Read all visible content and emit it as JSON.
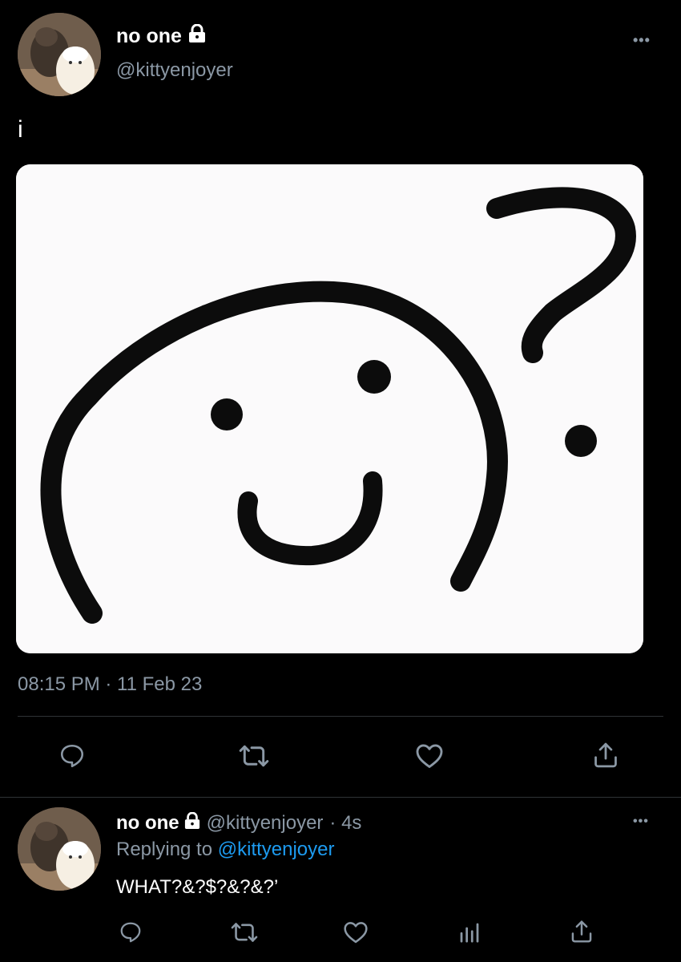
{
  "main_tweet": {
    "author_name": "no one",
    "author_handle": "@kittyenjoyer",
    "more_label": "•••",
    "text": "i",
    "timestamp": "08:15 PM · 11 Feb 23",
    "icons": {
      "reply": "reply-icon",
      "retweet": "retweet-icon",
      "like": "like-icon",
      "share": "share-icon",
      "lock": "lock-icon"
    }
  },
  "reply_tweet": {
    "author_name": "no one",
    "author_handle": "@kittyenjoyer",
    "time_ago": "· 4s",
    "replying_prefix": "Replying to",
    "replying_handle": "@kittyenjoyer",
    "text": "WHAT?&?$?&?&?’",
    "more_label": "•••",
    "icons": {
      "reply": "reply-icon",
      "retweet": "retweet-icon",
      "like": "like-icon",
      "analytics": "analytics-icon",
      "share": "share-icon"
    }
  },
  "colors": {
    "background": "#000000",
    "text": "#ffffff",
    "secondary": "#8b98a5",
    "link": "#1d9bf0",
    "divider": "#2f3336"
  }
}
